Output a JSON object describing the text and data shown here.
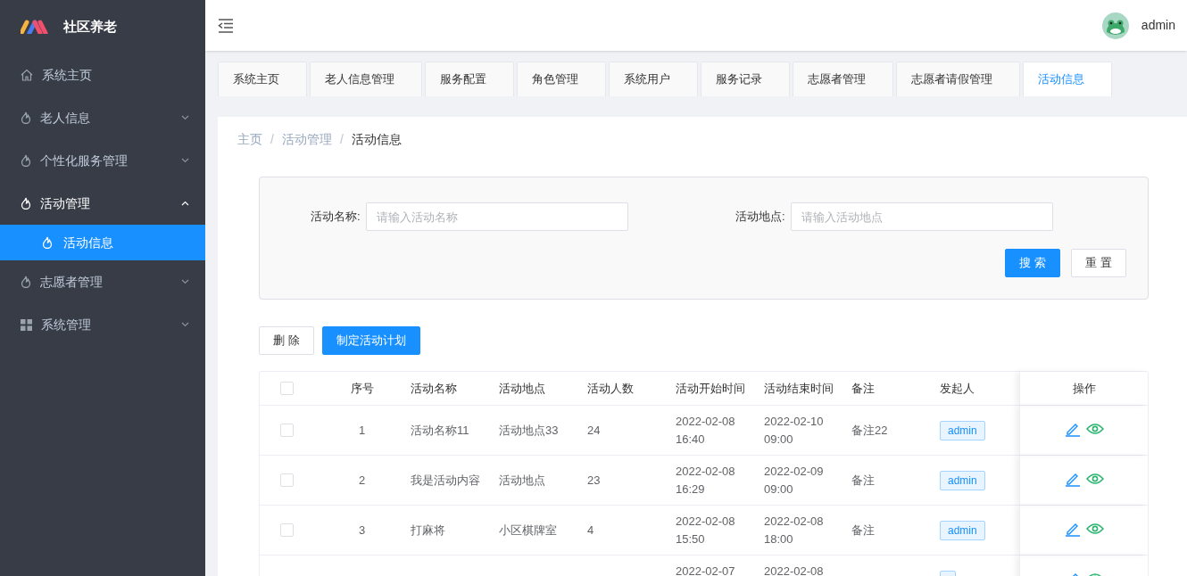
{
  "brand": {
    "title": "社区养老"
  },
  "sidebar": {
    "items": [
      {
        "label": "系统主页",
        "expanded": false,
        "selected": false
      },
      {
        "label": "老人信息",
        "has_children": true,
        "expanded": false,
        "selected": false
      },
      {
        "label": "个性化服务管理",
        "has_children": true,
        "expanded": false,
        "selected": false
      },
      {
        "label": "活动管理",
        "has_children": true,
        "expanded": true,
        "selected": false,
        "children": [
          {
            "label": "活动信息",
            "selected": true
          }
        ]
      },
      {
        "label": "志愿者管理",
        "has_children": true,
        "expanded": false,
        "selected": false
      },
      {
        "label": "系统管理",
        "has_children": true,
        "expanded": false,
        "selected": false
      }
    ]
  },
  "header": {
    "user": "admin"
  },
  "tabs": [
    {
      "label": "系统主页",
      "selected": false
    },
    {
      "label": "老人信息管理",
      "selected": false
    },
    {
      "label": "服务配置",
      "selected": false
    },
    {
      "label": "角色管理",
      "selected": false
    },
    {
      "label": "系统用户",
      "selected": false
    },
    {
      "label": "服务记录",
      "selected": false
    },
    {
      "label": "志愿者管理",
      "selected": false
    },
    {
      "label": "志愿者请假管理",
      "selected": false
    },
    {
      "label": "活动信息",
      "selected": true
    }
  ],
  "breadcrumb": {
    "separator": "/",
    "items": [
      "主页",
      "活动管理",
      "活动信息"
    ]
  },
  "search": {
    "fields": [
      {
        "label": "活动名称:",
        "placeholder": "请输入活动名称"
      },
      {
        "label": "活动地点:",
        "placeholder": "请输入活动地点"
      }
    ],
    "buttons": [
      "搜 索",
      "重 置"
    ]
  },
  "toolbar": {
    "buttons": [
      "删 除",
      "制定活动计划"
    ]
  },
  "table": {
    "select_all_checked": false,
    "columns": [
      "序号",
      "活动名称",
      "活动地点",
      "活动人数",
      "活动开始时间",
      "活动结束时间",
      "备注",
      "发起人",
      "操作"
    ],
    "rows": [
      {
        "checked": false,
        "index": "1",
        "name": "活动名称11",
        "place": "活动地点33",
        "count": "24",
        "start": [
          "2022-02-08",
          "16:40"
        ],
        "end": [
          "2022-02-10",
          "09:00"
        ],
        "note": "备注22",
        "initiator": "admin"
      },
      {
        "checked": false,
        "index": "2",
        "name": "我是活动内容",
        "place": "活动地点",
        "count": "23",
        "start": [
          "2022-02-08",
          "16:29"
        ],
        "end": [
          "2022-02-09",
          "09:00"
        ],
        "note": "备注",
        "initiator": "admin"
      },
      {
        "checked": false,
        "index": "3",
        "name": "打麻将",
        "place": "小区棋牌室",
        "count": "4",
        "start": [
          "2022-02-08",
          "15:50"
        ],
        "end": [
          "2022-02-08",
          "18:00"
        ],
        "note": "备注",
        "initiator": "admin"
      },
      {
        "start": [
          "2022-02-07"
        ],
        "end": [
          "2022-02-08"
        ]
      }
    ]
  }
}
